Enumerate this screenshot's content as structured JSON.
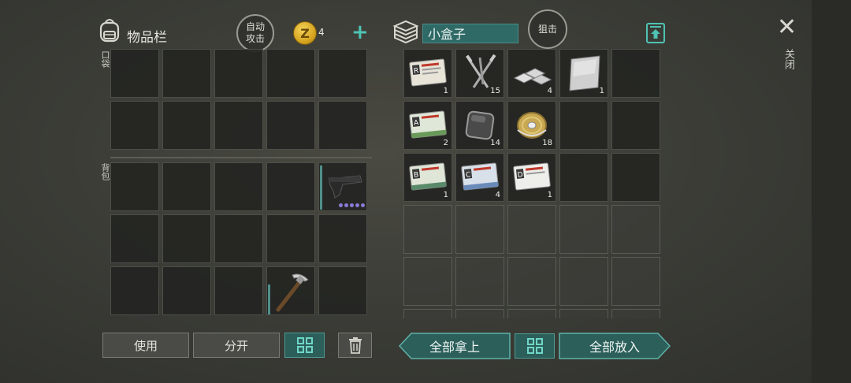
{
  "inventory": {
    "title": "物品栏",
    "auto_attack": [
      "自动",
      "攻击"
    ],
    "coin_count": "4",
    "pocket_label": "口袋",
    "backpack_label": "背包",
    "items": [
      {
        "name": "pistol",
        "durability_dots": 5
      },
      {
        "name": "pickaxe"
      }
    ]
  },
  "container": {
    "name": "小盒子",
    "snipe_label": "狙击",
    "items": [
      {
        "name": "army-card-r",
        "letter": "R",
        "count": "1"
      },
      {
        "name": "nails",
        "count": "15"
      },
      {
        "name": "metal-ingots",
        "count": "4"
      },
      {
        "name": "sheet-metal",
        "count": "1"
      },
      {
        "name": "army-card-a",
        "letter": "A",
        "count": "2"
      },
      {
        "name": "iron-plate",
        "count": "14"
      },
      {
        "name": "wire-spool",
        "count": "18"
      },
      {
        "name": "army-card-b",
        "letter": "B",
        "count": "1"
      },
      {
        "name": "army-card-c",
        "letter": "C",
        "count": "4"
      },
      {
        "name": "army-card-d",
        "letter": "D",
        "count": "1"
      }
    ]
  },
  "buttons": {
    "use": "使用",
    "split": "分开",
    "take_all": "全部拿上",
    "put_all": "全部放入"
  },
  "close_label": "关闭",
  "colors": {
    "accent_teal": "#2d5f5a",
    "teal_icon": "#4fc3b4",
    "coin_gold": "#d6a520"
  }
}
